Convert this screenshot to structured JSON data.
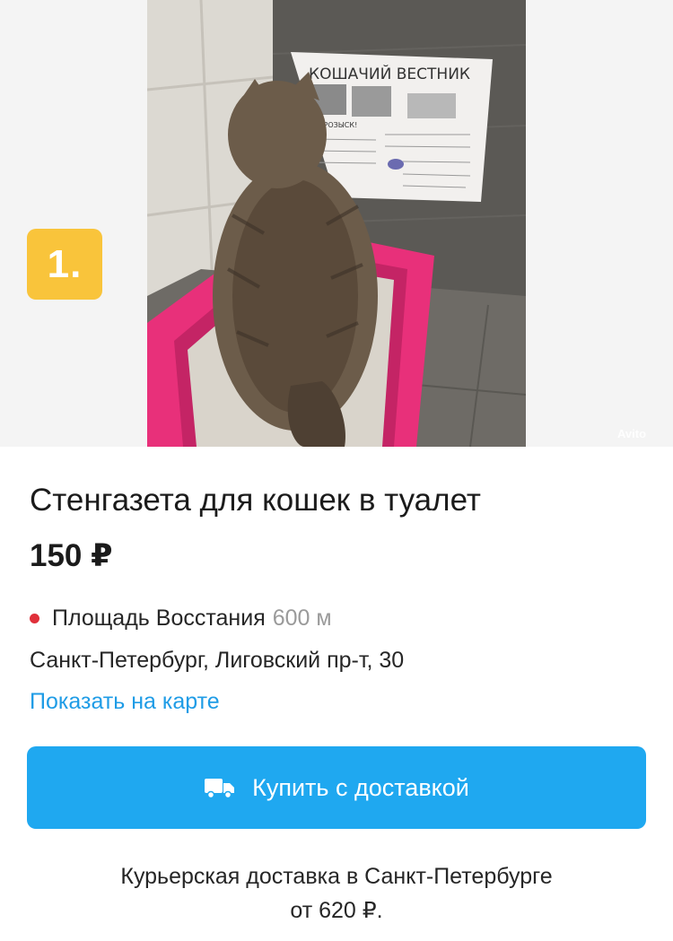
{
  "photo": {
    "badge": "1.",
    "poster_title": "КОШАЧИЙ ВЕСТНИК",
    "poster_heading": "МЕ РОЗЫСК!",
    "watermark": "Avito"
  },
  "listing": {
    "title": "Стенгазета для кошек в туалет",
    "price": "150 ₽",
    "metro_station": "Площадь Восстания",
    "metro_distance": "600 м",
    "address": "Санкт-Петербург, Лиговский пр-т, 30",
    "map_link": "Показать на карте"
  },
  "buy": {
    "label": "Купить с доставкой"
  },
  "delivery": {
    "line1": "Курьерская доставка в Санкт-Петербурге",
    "line2": "от 620 ₽."
  },
  "colors": {
    "accent_blue": "#1fa8f0",
    "link_blue": "#1f9ce6",
    "badge_yellow": "#f9c43b",
    "metro_red": "#e0303a",
    "litter_box_pink": "#e8307a"
  }
}
